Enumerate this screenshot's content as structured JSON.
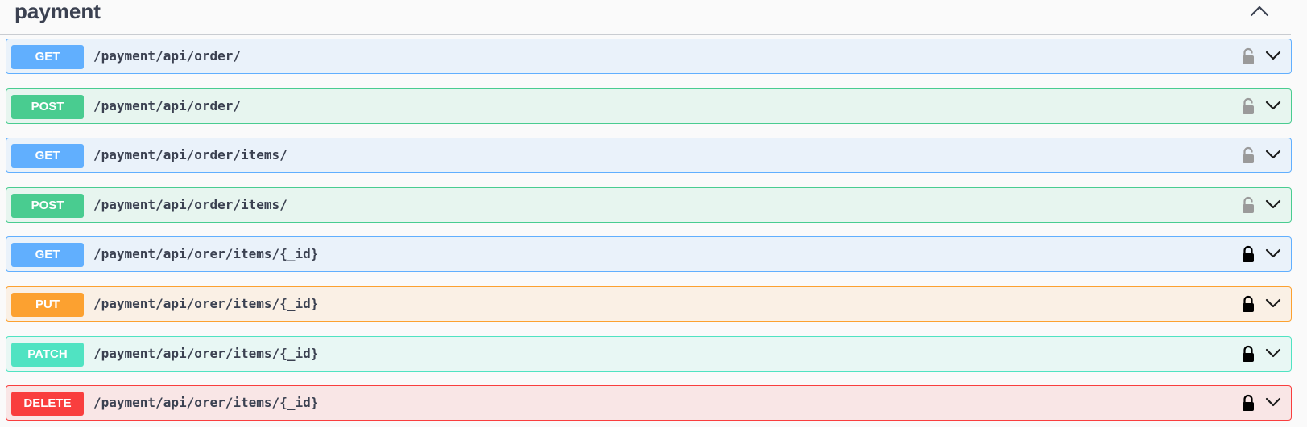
{
  "section": {
    "title": "payment",
    "toggle_icon": "chevron-up-icon"
  },
  "colors": {
    "GET": "#61affe",
    "POST": "#49cc90",
    "PUT": "#fca130",
    "PATCH": "#50e3c2",
    "DELETE": "#f93e3e",
    "lock_unlocked": "#9a9a9a",
    "lock_locked": "#000000"
  },
  "operations": [
    {
      "method": "GET",
      "path": "/payment/api/order/",
      "lock": "unlocked"
    },
    {
      "method": "POST",
      "path": "/payment/api/order/",
      "lock": "unlocked"
    },
    {
      "method": "GET",
      "path": "/payment/api/order/items/",
      "lock": "unlocked"
    },
    {
      "method": "POST",
      "path": "/payment/api/order/items/",
      "lock": "unlocked"
    },
    {
      "method": "GET",
      "path": "/payment/api/orer/items/{_id}",
      "lock": "locked"
    },
    {
      "method": "PUT",
      "path": "/payment/api/orer/items/{_id}",
      "lock": "locked"
    },
    {
      "method": "PATCH",
      "path": "/payment/api/orer/items/{_id}",
      "lock": "locked"
    },
    {
      "method": "DELETE",
      "path": "/payment/api/orer/items/{_id}",
      "lock": "locked"
    }
  ]
}
